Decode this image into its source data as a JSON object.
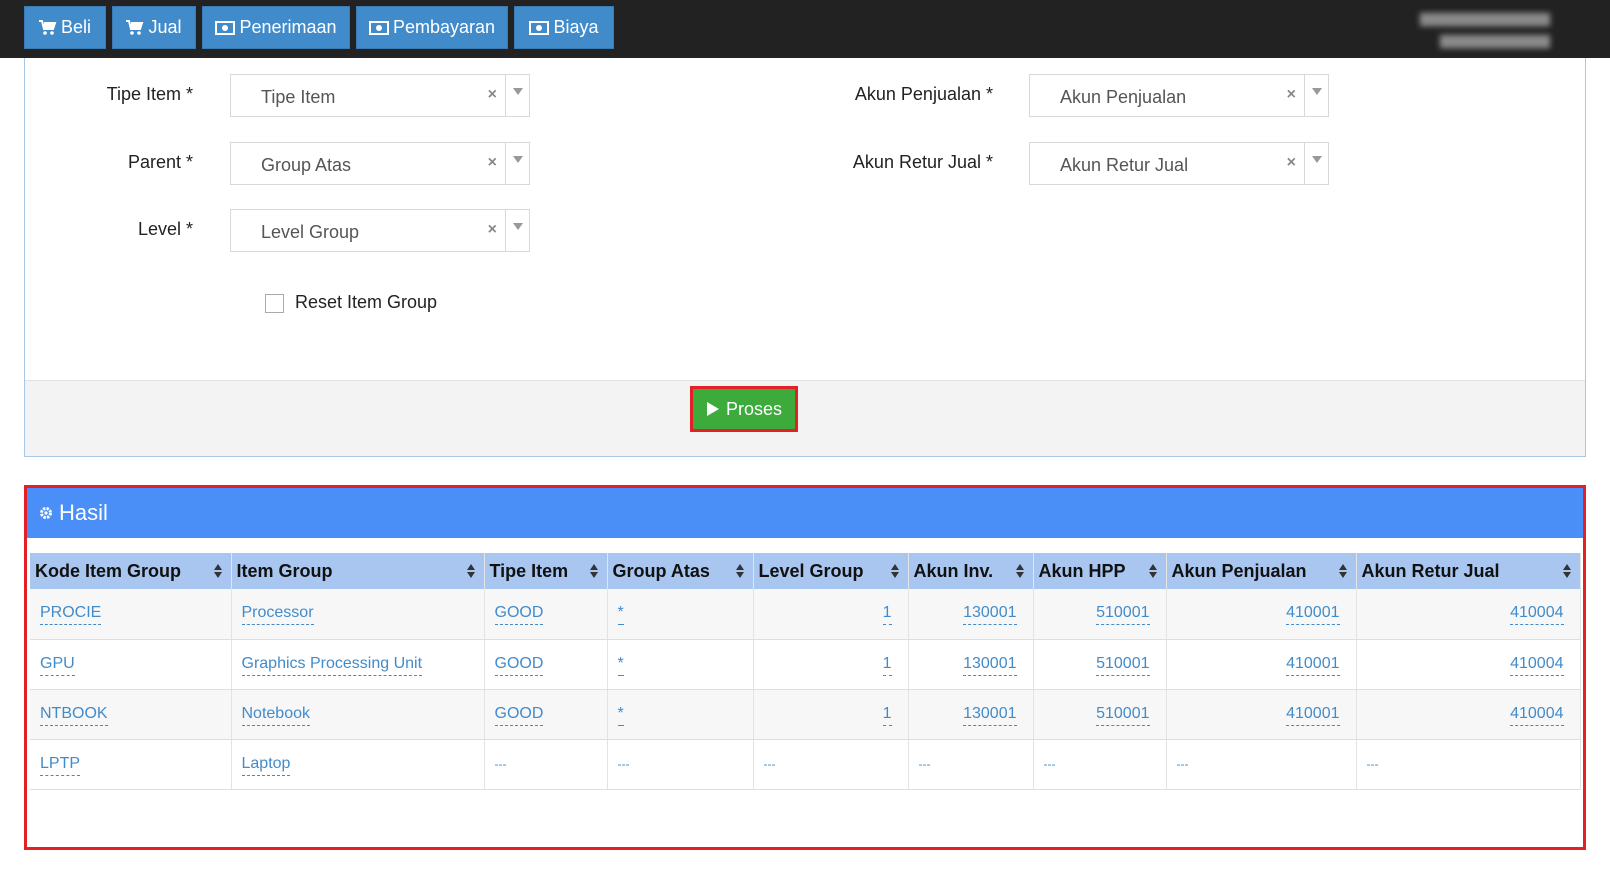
{
  "topbar": {
    "buttons": [
      {
        "label": "Beli",
        "icon": "cart-icon"
      },
      {
        "label": "Jual",
        "icon": "cart-icon"
      },
      {
        "label": "Penerimaan",
        "icon": "money-icon"
      },
      {
        "label": "Pembayaran",
        "icon": "money-icon"
      },
      {
        "label": "Biaya",
        "icon": "money-icon"
      }
    ]
  },
  "form": {
    "tipe_item": {
      "label": "Tipe Item *",
      "placeholder": "Tipe Item"
    },
    "parent": {
      "label": "Parent *",
      "placeholder": "Group Atas"
    },
    "level": {
      "label": "Level *",
      "placeholder": "Level Group"
    },
    "akun_penjualan": {
      "label": "Akun Penjualan *",
      "placeholder": "Akun Penjualan"
    },
    "akun_retur_jual": {
      "label": "Akun Retur Jual *",
      "placeholder": "Akun Retur Jual"
    },
    "clear_glyph": "×",
    "reset_label": "Reset Item Group",
    "proses_label": "Proses"
  },
  "result": {
    "title": "Hasil",
    "columns": [
      "Kode Item Group",
      "Item Group",
      "Tipe Item",
      "Group Atas",
      "Level Group",
      "Akun Inv.",
      "Akun HPP",
      "Akun Penjualan",
      "Akun Retur Jual"
    ],
    "rows": [
      [
        "PROCIE",
        "Processor",
        "GOOD",
        "*",
        "1",
        "130001",
        "510001",
        "410001",
        "410004"
      ],
      [
        "GPU",
        "Graphics Processing Unit",
        "GOOD",
        "*",
        "1",
        "130001",
        "510001",
        "410001",
        "410004"
      ],
      [
        "NTBOOK",
        "Notebook",
        "GOOD",
        "*",
        "1",
        "130001",
        "510001",
        "410001",
        "410004"
      ],
      [
        "LPTP",
        "Laptop",
        "",
        "",
        "",
        "",
        "",
        "",
        ""
      ]
    ],
    "empty_marker": "---"
  },
  "colors": {
    "topbar": "#222222",
    "button": "#428bca",
    "proses": "#3cab3c",
    "header": "#4a8ff7",
    "table_head": "#a9c6f0",
    "highlight": "#e32026",
    "link": "#428bca"
  }
}
